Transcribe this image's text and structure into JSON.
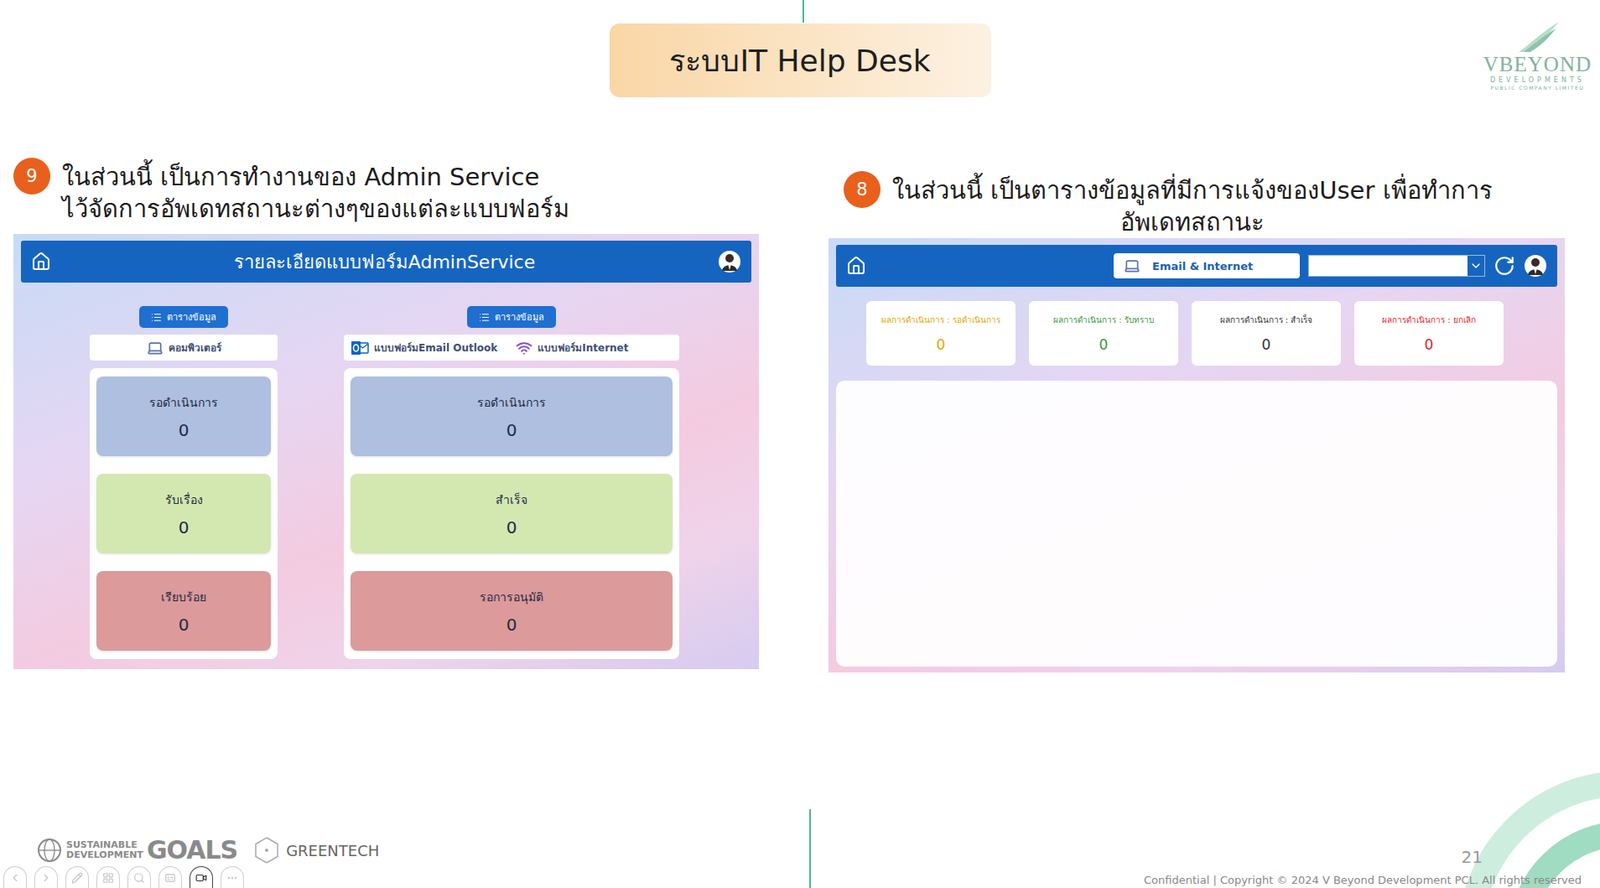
{
  "slide": {
    "title": "ระบบIT Help Desk",
    "page_number": "21",
    "copyright": "Confidential | Copyright © 2024 V Beyond Development PCL. All rights reserved"
  },
  "logo": {
    "name": "VBEYOND",
    "line": "DEVELOPMENTS",
    "tagline": "PUBLIC COMPANY LIMITED"
  },
  "footer": {
    "sdg": {
      "lines": [
        "SUSTAINABLE",
        "DEVELOPMENT"
      ],
      "goals": "GOALS"
    },
    "partner": "GREENTECH"
  },
  "presenter_controls": [
    {
      "kind": "previous",
      "selected": false
    },
    {
      "kind": "next",
      "selected": false
    },
    {
      "kind": "pen",
      "selected": false
    },
    {
      "kind": "slides",
      "selected": false
    },
    {
      "kind": "zoom",
      "selected": false
    },
    {
      "kind": "subtitles",
      "selected": false
    },
    {
      "kind": "camera",
      "selected": true
    },
    {
      "kind": "more",
      "selected": false
    }
  ],
  "admin_section": {
    "badge": "9",
    "caption": [
      "ในส่วนนี้ เป็นการทำงานของ Admin Service",
      "ไว้จัดการอัพเดทสถานะต่างๆของแต่ละแบบฟอร์ม"
    ],
    "screen": {
      "title": "รายละเอียดแบบฟอร์มAdminService",
      "panels": [
        {
          "button": "ตารางข้อมูล",
          "tabs": [
            {
              "label": "คอมพิวเตอร์",
              "kind": "computer"
            }
          ],
          "cards": [
            {
              "label": "รอดำเนินการ",
              "value": "0",
              "color": "#aebfe0"
            },
            {
              "label": "รับเรื่อง",
              "value": "0",
              "color": "#d3e8b0"
            },
            {
              "label": "เรียบร้อย",
              "value": "0",
              "color": "#dc9a9b"
            }
          ]
        },
        {
          "button": "ตารางข้อมูล",
          "tabs": [
            {
              "label": "แบบฟอร์มEmail Outlook",
              "kind": "outlook"
            },
            {
              "label": "แบบฟอร์มInternet",
              "kind": "wifi"
            }
          ],
          "cards": [
            {
              "label": "รอดำเนินการ",
              "value": "0",
              "color": "#aebfe0"
            },
            {
              "label": "สำเร็จ",
              "value": "0",
              "color": "#d3e8b0"
            },
            {
              "label": "รอการอนุมัติ",
              "value": "0",
              "color": "#dc9a9b"
            }
          ]
        }
      ]
    }
  },
  "user_section": {
    "badge": "8",
    "caption": [
      "ในส่วนนี้ เป็นตารางข้อมูลที่มีการแจ้งของUser เพื่อทำการ",
      "อัพเดทสถานะ"
    ],
    "screen": {
      "category_button": "Email & Internet",
      "dropdown": {
        "value": ""
      },
      "stats": [
        {
          "label": "ผลการดำเนินการ : รอดำเนินการ",
          "value": "0",
          "color": "#e0a800"
        },
        {
          "label": "ผลการดำเนินการ : รับทราบ",
          "value": "0",
          "color": "#3c9a3c"
        },
        {
          "label": "ผลการดำเนินการ : สำเร็จ",
          "value": "0",
          "color": "#333333"
        },
        {
          "label": "ผลการดำเนินการ : ยกเลิก",
          "value": "0",
          "color": "#e5262b"
        }
      ],
      "table": {
        "rows": []
      }
    }
  }
}
